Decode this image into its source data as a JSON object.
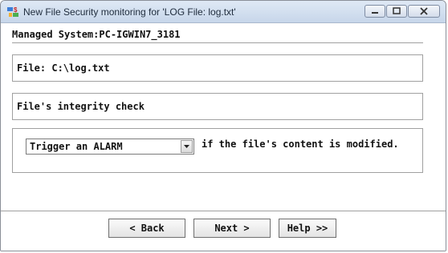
{
  "window": {
    "title": "New File Security monitoring for 'LOG File: log.txt'",
    "icon": "app-icon"
  },
  "titlebar_buttons": {
    "minimize": "minimize-icon",
    "maximize": "maximize-icon",
    "close": "close-icon"
  },
  "content": {
    "managed_system": "Managed System:PC-IGWIN7_3181",
    "file_label": "File: C:\\log.txt",
    "integrity_label": "File's integrity check",
    "trigger_select": {
      "selected": "Trigger an ALARM"
    },
    "trigger_suffix": "if the file's content is modified."
  },
  "buttons": {
    "back": "< Back",
    "next": "Next >",
    "help": "Help >>"
  },
  "colors": {
    "titlebar": "#c7d6ea",
    "border": "#a0a0a0"
  }
}
